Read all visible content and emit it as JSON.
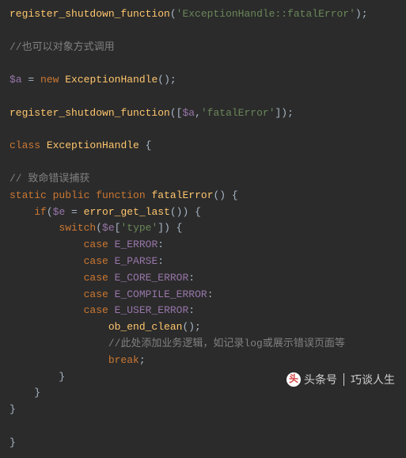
{
  "code": {
    "l1_fn": "register_shutdown_function",
    "l1_str": "'ExceptionHandle::fatalError'",
    "l3_cmt": "//也可以对象方式调用",
    "l5_var": "$a",
    "l5_kw_new": "new",
    "l5_cls": "ExceptionHandle",
    "l7_fn": "register_shutdown_function",
    "l7_var": "$a",
    "l7_str": "'fatalError'",
    "l9_kw_class": "class",
    "l9_cls": "ExceptionHandle",
    "l11_cmt": "// 致命错误捕获",
    "l12_kw_static": "static",
    "l12_kw_public": "public",
    "l12_kw_function": "function",
    "l12_fn": "fatalError",
    "l13_kw_if": "if",
    "l13_var": "$e",
    "l13_fn": "error_get_last",
    "l14_kw_switch": "switch",
    "l14_var": "$e",
    "l14_str": "'type'",
    "l15_kw_case": "case",
    "l15_const": "E_ERROR",
    "l16_kw_case": "case",
    "l16_const": "E_PARSE",
    "l17_kw_case": "case",
    "l17_const": "E_CORE_ERROR",
    "l18_kw_case": "case",
    "l18_const": "E_COMPILE_ERROR",
    "l19_kw_case": "case",
    "l19_const": "E_USER_ERROR",
    "l20_fn": "ob_end_clean",
    "l21_cmt": "//此处添加业务逻辑，如记录log或展示错误页面等",
    "l22_kw_break": "break"
  },
  "watermark": {
    "brand": "头条号",
    "author": "巧谈人生"
  }
}
